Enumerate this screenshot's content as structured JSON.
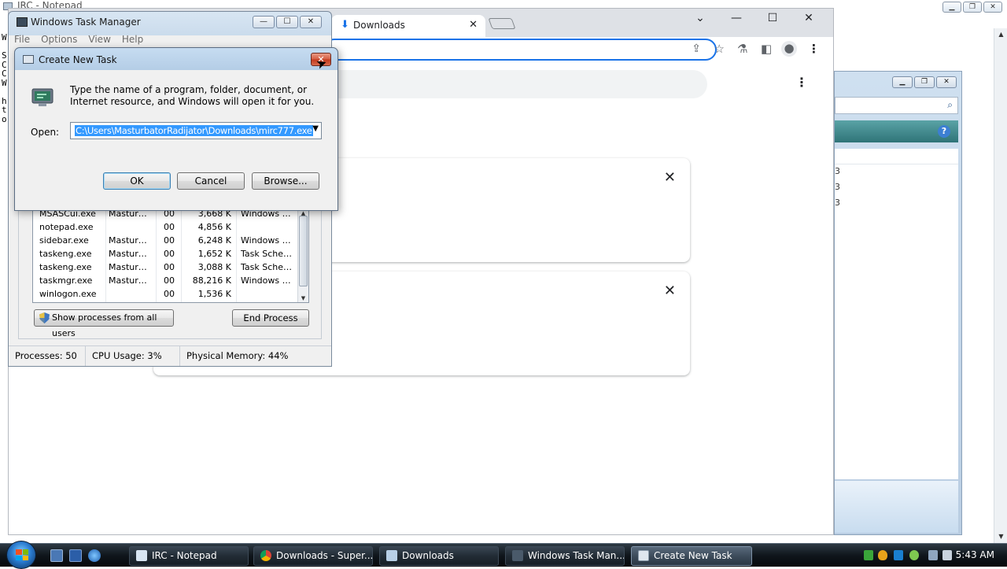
{
  "notepad": {
    "title": "IRC - Notepad",
    "text_fragments": [
      "W",
      "",
      "S",
      "C",
      "C",
      "W",
      "",
      "h",
      "t",
      "o"
    ]
  },
  "chrome": {
    "tab_label": "Downloads",
    "tab_close": "✕",
    "window_controls": [
      "⌄",
      "—",
      "☐",
      "✕"
    ],
    "card_close": "✕"
  },
  "taskmgr": {
    "title": "Windows Task Manager",
    "menu": [
      "File",
      "Options",
      "View",
      "Help"
    ],
    "window_controls": [
      "—",
      "☐",
      "✕"
    ],
    "processes": [
      {
        "name": "MSASCui.exe",
        "user": "Mastur…",
        "cpu": "00",
        "mem": "3,668 K",
        "desc": "Windows …"
      },
      {
        "name": "notepad.exe",
        "user": "",
        "cpu": "00",
        "mem": "4,856 K",
        "desc": ""
      },
      {
        "name": "sidebar.exe",
        "user": "Mastur…",
        "cpu": "00",
        "mem": "6,248 K",
        "desc": "Windows …"
      },
      {
        "name": "taskeng.exe",
        "user": "Mastur…",
        "cpu": "00",
        "mem": "1,652 K",
        "desc": "Task Sche…"
      },
      {
        "name": "taskeng.exe",
        "user": "Mastur…",
        "cpu": "00",
        "mem": "3,088 K",
        "desc": "Task Sche…"
      },
      {
        "name": "taskmgr.exe",
        "user": "Mastur…",
        "cpu": "00",
        "mem": "88,216 K",
        "desc": "Windows …"
      },
      {
        "name": "winlogon.exe",
        "user": "",
        "cpu": "00",
        "mem": "1,536 K",
        "desc": ""
      }
    ],
    "show_all_label": "Show processes from all users",
    "end_process_label": "End Process",
    "status": {
      "processes": "Processes: 50",
      "cpu": "CPU Usage: 3%",
      "memory": "Physical Memory: 44%"
    }
  },
  "dialog": {
    "title": "Create New Task",
    "description": "Type the name of a program, folder, document, or Internet resource, and Windows will open it for you.",
    "open_label": "Open:",
    "open_value": "C:\\Users\\MasturbatorRadijator\\Downloads\\mirc777.exe",
    "ok_label": "OK",
    "cancel_label": "Cancel",
    "browse_label": "Browse...",
    "close_glyph": "✕"
  },
  "right_window": {
    "list_fragments": [
      "3",
      "3",
      "3"
    ],
    "help_glyph": "?"
  },
  "taskbar": {
    "buttons": [
      {
        "label": "IRC - Notepad"
      },
      {
        "label": "Downloads - Super..."
      },
      {
        "label": "Downloads"
      },
      {
        "label": "Windows Task Man..."
      },
      {
        "label": "Create New Task"
      }
    ],
    "clock": "5:43 AM"
  }
}
